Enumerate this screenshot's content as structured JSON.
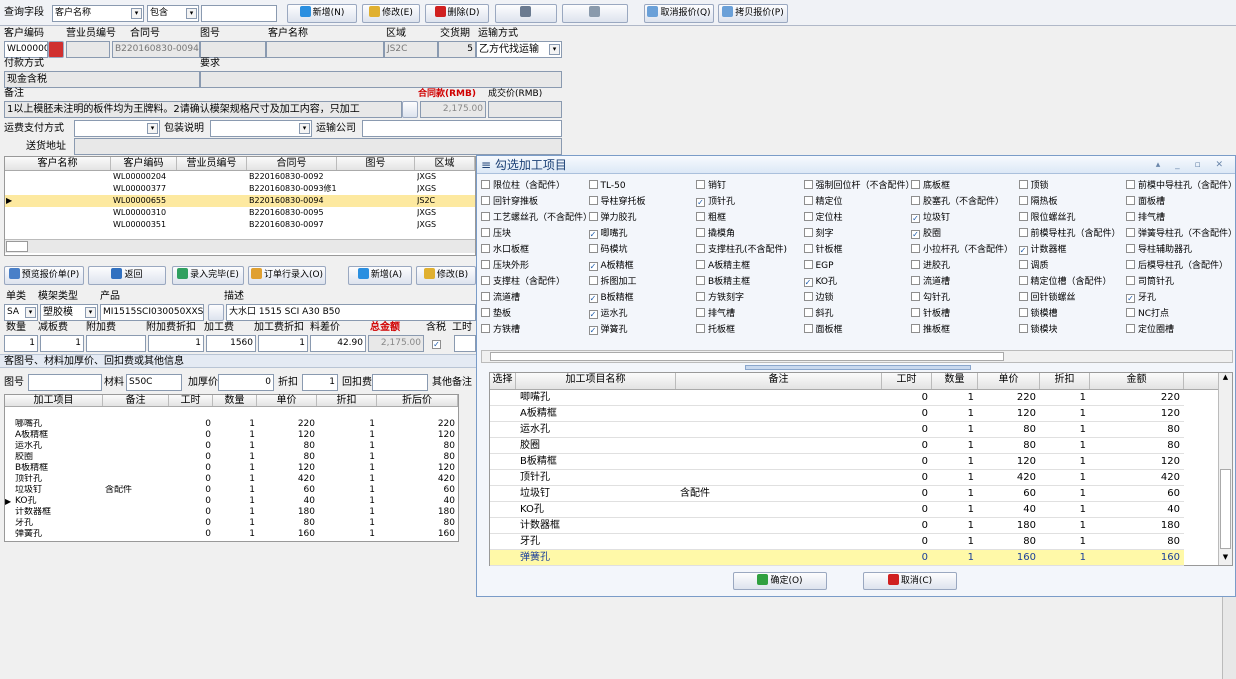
{
  "toolbar": {
    "query_label": "查询字段",
    "field_select": "客户名称",
    "op_select": "包含",
    "query_value": "",
    "new": "新增(N)",
    "edit": "修改(E)",
    "delete": "删除(D)",
    "cancel_quote": "取消报价(Q)",
    "copy_quote": "拷贝报价(P)"
  },
  "header": {
    "labels": {
      "customer_code": "客户编码",
      "sales_code": "营业员编号",
      "contract_no": "合同号",
      "drawing_no": "图号",
      "customer_name": "客户名称",
      "region": "区域",
      "delivery": "交货期",
      "transport": "运输方式",
      "payment": "付款方式",
      "requirement": "要求",
      "remark": "备注",
      "contract_amount": "合同款(RMB)",
      "deal_price": "成交价(RMB)",
      "freight_pay": "运费支付方式",
      "packing": "包装说明",
      "carrier": "运输公司",
      "address": "送货地址"
    },
    "values": {
      "customer_code": "WL000006",
      "contract_no": "B220160830-0094",
      "region": "JS2C",
      "delivery": "5",
      "transport": "乙方代找运输",
      "payment": "现金含税",
      "remark": "1以上模胚未注明的板件均为王牌料。2请确认模架规格尺寸及加工内容，只加工",
      "amount": "2,175.00"
    }
  },
  "customers": {
    "columns": [
      "客户名称",
      "客户编码",
      "营业员编号",
      "合同号",
      "图号",
      "区域"
    ],
    "rows": [
      [
        "",
        "WL00000204",
        "",
        "B220160830-0092",
        "",
        "JXGS"
      ],
      [
        "",
        "WL00000377",
        "",
        "B220160830-0093修1",
        "",
        "JXGS"
      ],
      [
        "",
        "WL00000655",
        "",
        "B220160830-0094",
        "",
        "JS2C"
      ],
      [
        "",
        "WL00000310",
        "",
        "B220160830-0095",
        "",
        "JXGS"
      ],
      [
        "",
        "WL00000351",
        "",
        "B220160830-0097",
        "",
        "JXGS"
      ]
    ]
  },
  "actions": {
    "preview": "预览报价单(P)",
    "back": "返回",
    "entry_done": "录入完毕(E)",
    "order_entry": "订单行录入(O)",
    "new": "新增(A)",
    "edit": "修改(B)"
  },
  "detail": {
    "labels": {
      "unit": "单类",
      "mold_type": "模架类型",
      "product": "产品",
      "desc": "描述",
      "qty": "数量",
      "reduce": "减板费",
      "extra": "附加费",
      "extra_disc": "附加费折扣",
      "proc_fee": "加工费",
      "proc_disc": "加工费折扣",
      "material_diff": "料差价",
      "total": "总金额",
      "tax": "含税",
      "hours": "工时"
    },
    "values": {
      "unit": "SA",
      "mold_type": "塑胶模",
      "product": "MI1515SCI030050XXS",
      "desc": "大水口 1515 SCI A30 B50",
      "qty": "1",
      "reduce": "1",
      "extra_disc": "1",
      "proc_fee": "1560",
      "proc_disc": "1",
      "material_diff": "42.90",
      "total": "2,175.00"
    }
  },
  "section2": {
    "title": "客图号、材料加厚价、回扣费或其他信息",
    "drawing": "图号",
    "material": "材料",
    "material_val": "S50C",
    "thick": "加厚价",
    "thick_val": "0",
    "disc": "折扣",
    "disc_val": "1",
    "rebate": "回扣费",
    "other": "其他备注"
  },
  "proc_table": {
    "columns": [
      "加工项目",
      "备注",
      "工时",
      "数量",
      "单价",
      "折扣",
      "折后价"
    ],
    "rows": [
      [
        "哪嘴孔",
        "",
        "0",
        "1",
        "220",
        "1",
        "220"
      ],
      [
        "A板精框",
        "",
        "0",
        "1",
        "120",
        "1",
        "120"
      ],
      [
        "运水孔",
        "",
        "0",
        "1",
        "80",
        "1",
        "80"
      ],
      [
        "胶圈",
        "",
        "0",
        "1",
        "80",
        "1",
        "80"
      ],
      [
        "B板精框",
        "",
        "0",
        "1",
        "120",
        "1",
        "120"
      ],
      [
        "顶针孔",
        "",
        "0",
        "1",
        "420",
        "1",
        "420"
      ],
      [
        "垃圾钉",
        "含配件",
        "0",
        "1",
        "60",
        "1",
        "60"
      ],
      [
        "KO孔",
        "",
        "0",
        "1",
        "40",
        "1",
        "40"
      ],
      [
        "计数器框",
        "",
        "0",
        "1",
        "180",
        "1",
        "180"
      ],
      [
        "牙孔",
        "",
        "0",
        "1",
        "80",
        "1",
        "80"
      ],
      [
        "弹簧孔",
        "",
        "0",
        "1",
        "160",
        "1",
        "160"
      ]
    ]
  },
  "dialog": {
    "title": "勾选加工项目",
    "ok": "确定(O)",
    "cancel": "取消(C)",
    "options": [
      [
        "限位柱（含配件）",
        false
      ],
      [
        "TL-50",
        false
      ],
      [
        "销钉",
        false
      ],
      [
        "强制回位杆（不含配件）",
        false
      ],
      [
        "底板框",
        false
      ],
      [
        "顶锁",
        false
      ],
      [
        "前模中导柱孔（含配件）",
        false
      ],
      [
        "回针穿推板",
        false
      ],
      [
        "导柱穿托板",
        false
      ],
      [
        "顶针孔",
        true
      ],
      [
        "精定位",
        false
      ],
      [
        "胶塞孔（不含配件）",
        false
      ],
      [
        "隔热板",
        false
      ],
      [
        "面板槽",
        false
      ],
      [
        "工艺螺丝孔（不含配件）",
        false
      ],
      [
        "弹力胶孔",
        false
      ],
      [
        "粗框",
        false
      ],
      [
        "定位柱",
        false
      ],
      [
        "垃圾钉",
        true
      ],
      [
        "限位螺丝孔",
        false
      ],
      [
        "排气槽",
        false
      ],
      [
        "压块",
        false
      ],
      [
        "唧嘴孔",
        true
      ],
      [
        "撬模角",
        false
      ],
      [
        "刻字",
        false
      ],
      [
        "胶圈",
        true
      ],
      [
        "前模导柱孔（含配件）",
        false
      ],
      [
        "弹簧导柱孔（不含配件）",
        false
      ],
      [
        "水口板框",
        false
      ],
      [
        "码模坑",
        false
      ],
      [
        "支撑柱孔(不含配件)",
        false
      ],
      [
        "针板框",
        false
      ],
      [
        "小拉杆孔（不含配件）",
        false
      ],
      [
        "计数器框",
        true
      ],
      [
        "导柱辅助器孔",
        false
      ],
      [
        "压块外形",
        false
      ],
      [
        "A板精框",
        true
      ],
      [
        "A板精主框",
        false
      ],
      [
        "EGP",
        false
      ],
      [
        "进胶孔",
        false
      ],
      [
        "调质",
        false
      ],
      [
        "后模导柱孔（含配件）",
        false
      ],
      [
        "支撑柱（含配件）",
        false
      ],
      [
        "拆图加工",
        false
      ],
      [
        "B板精主框",
        false
      ],
      [
        "KO孔",
        true
      ],
      [
        "流道槽",
        false
      ],
      [
        "精定位槽（含配件）",
        false
      ],
      [
        "司筒针孔",
        false
      ],
      [
        "流道槽",
        false
      ],
      [
        "B板精框",
        true
      ],
      [
        "方铁刻字",
        false
      ],
      [
        "边锁",
        false
      ],
      [
        "勾针孔",
        false
      ],
      [
        "回针锁螺丝",
        false
      ],
      [
        "牙孔",
        true
      ],
      [
        "垫板",
        false
      ],
      [
        "运水孔",
        true
      ],
      [
        "排气槽",
        false
      ],
      [
        "斜孔",
        false
      ],
      [
        "针板槽",
        false
      ],
      [
        "锁模槽",
        false
      ],
      [
        "NC打点",
        false
      ],
      [
        "方铁槽",
        false
      ],
      [
        "弹簧孔",
        true
      ],
      [
        "托板框",
        false
      ],
      [
        "面板框",
        false
      ],
      [
        "推板框",
        false
      ],
      [
        "锁模块",
        false
      ],
      [
        "定位圈槽",
        false
      ]
    ],
    "grid_columns": [
      "选择",
      "加工项目名称",
      "备注",
      "工时",
      "数量",
      "单价",
      "折扣",
      "金额"
    ],
    "grid_rows": [
      [
        "唧嘴孔",
        "",
        "0",
        "1",
        "220",
        "1",
        "220"
      ],
      [
        "A板精框",
        "",
        "0",
        "1",
        "120",
        "1",
        "120"
      ],
      [
        "运水孔",
        "",
        "0",
        "1",
        "80",
        "1",
        "80"
      ],
      [
        "胶圈",
        "",
        "0",
        "1",
        "80",
        "1",
        "80"
      ],
      [
        "B板精框",
        "",
        "0",
        "1",
        "120",
        "1",
        "120"
      ],
      [
        "顶针孔",
        "",
        "0",
        "1",
        "420",
        "1",
        "420"
      ],
      [
        "垃圾钉",
        "含配件",
        "0",
        "1",
        "60",
        "1",
        "60"
      ],
      [
        "KO孔",
        "",
        "0",
        "1",
        "40",
        "1",
        "40"
      ],
      [
        "计数器框",
        "",
        "0",
        "1",
        "180",
        "1",
        "180"
      ],
      [
        "牙孔",
        "",
        "0",
        "1",
        "80",
        "1",
        "80"
      ],
      [
        "弹簧孔",
        "",
        "0",
        "1",
        "160",
        "1",
        "160"
      ]
    ]
  },
  "colors": {
    "accent": "#1a3f74",
    "highlight": "#fff9a8",
    "selected_row": "#fde9a0",
    "red": "#d00000"
  }
}
